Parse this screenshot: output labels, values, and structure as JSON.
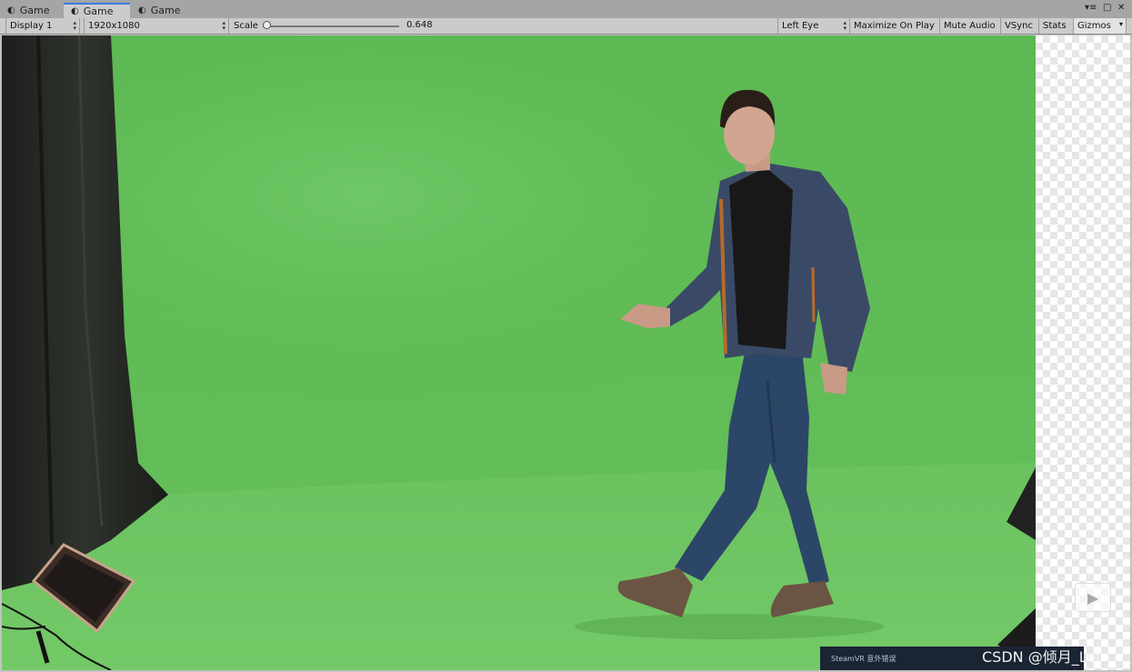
{
  "tabs": [
    {
      "label": "Game",
      "active": false
    },
    {
      "label": "Game",
      "active": true
    },
    {
      "label": "Game",
      "active": false
    }
  ],
  "icons": {
    "tab": "unity-game-icon",
    "menu": "menu-icon",
    "maximize": "maximize-icon",
    "close": "close-icon",
    "play": "play-icon"
  },
  "toolbar": {
    "display": "Display 1",
    "resolution": "1920x1080",
    "scale_label": "Scale",
    "scale_value": "0.648",
    "eye": "Left Eye",
    "maximize": "Maximize On Play",
    "mute": "Mute Audio",
    "vsync": "VSync",
    "stats": "Stats",
    "gizmos": "Gizmos"
  },
  "overlay": {
    "steamvr": "SteamVR 意外错误",
    "watermark": "CSDN @倾月_Lei"
  },
  "colors": {
    "greenscreen": "#6abd5e",
    "accent": "#3b7be0"
  }
}
